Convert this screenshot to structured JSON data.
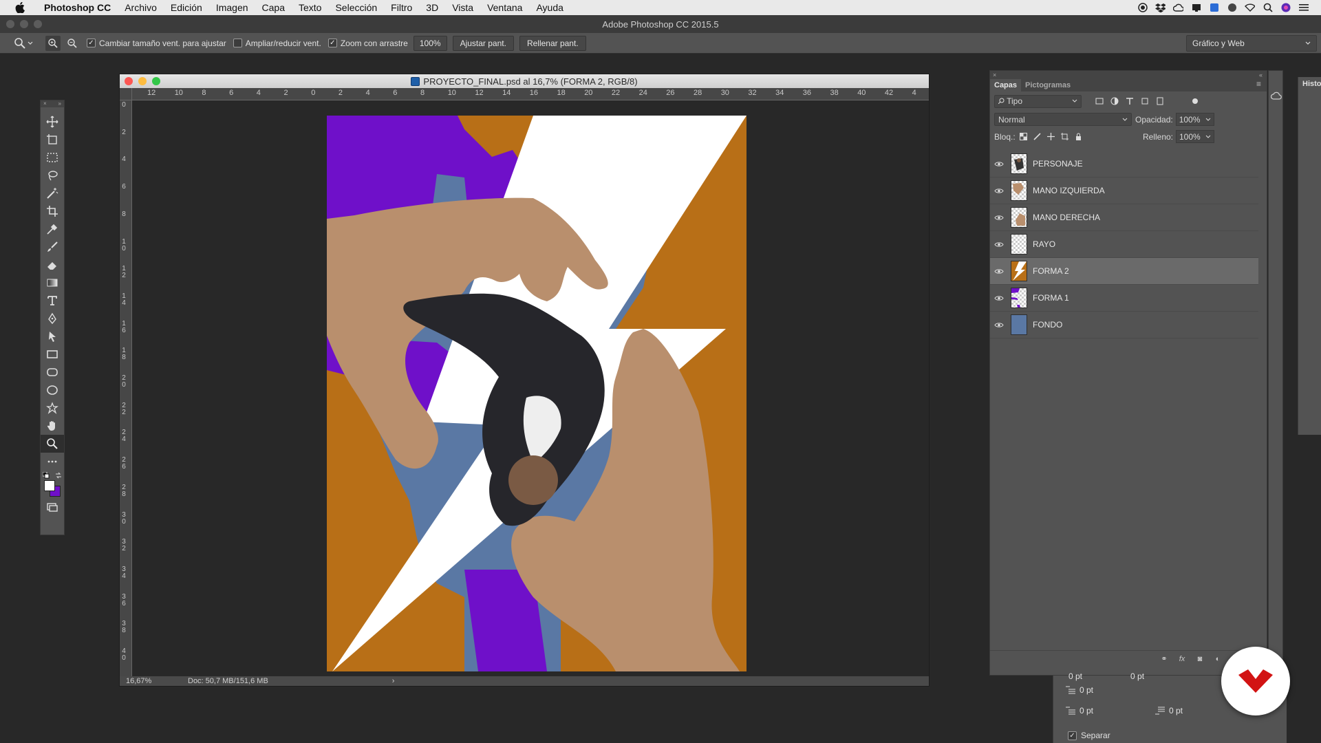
{
  "menubar": {
    "app_name": "Photoshop CC",
    "items": [
      "Archivo",
      "Edición",
      "Imagen",
      "Capa",
      "Texto",
      "Selección",
      "Filtro",
      "3D",
      "Vista",
      "Ventana",
      "Ayuda"
    ]
  },
  "app_title": "Adobe Photoshop CC 2015.5",
  "options": {
    "resize_windows_label": "Cambiar tamaño vent. para ajustar",
    "resize_windows_checked": true,
    "zoom_all_windows_label": "Ampliar/reducir vent.",
    "zoom_all_windows_checked": false,
    "scrubby_zoom_label": "Zoom con arrastre",
    "scrubby_zoom_checked": true,
    "zoom_value": "100%",
    "fit_screen_label": "Ajustar pant.",
    "fill_screen_label": "Rellenar pant.",
    "workspace_label": "Gráfico y Web"
  },
  "document": {
    "title": "PROYECTO_FINAL.psd al 16,7% (FORMA 2, RGB/8)",
    "ruler_h": [
      "12",
      "10",
      "8",
      "6",
      "4",
      "2",
      "0",
      "2",
      "4",
      "6",
      "8",
      "10",
      "12",
      "14",
      "16",
      "18",
      "20",
      "22",
      "24",
      "26",
      "28",
      "30",
      "32",
      "34",
      "36",
      "38",
      "40",
      "42",
      "4"
    ],
    "ruler_v": [
      "0",
      "2",
      "4",
      "6",
      "8",
      "1\n0",
      "1\n2",
      "1\n4",
      "1\n6",
      "1\n8",
      "2\n0",
      "2\n2",
      "2\n4",
      "2\n6",
      "2\n8",
      "3\n0",
      "3\n2",
      "3\n4",
      "3\n6",
      "3\n8",
      "4\n0"
    ],
    "zoom_status": "16,67%",
    "doc_info": "Doc: 50,7 MB/151,6 MB",
    "status_arrow": "›",
    "colors": {
      "purple": "#6f10c9",
      "orange": "#b86f17",
      "blue": "#5a78a4",
      "white": "#ffffff"
    }
  },
  "layers_panel": {
    "tabs": [
      "Capas",
      "Pictogramas"
    ],
    "filter_label": "Tipo",
    "blend_mode": "Normal",
    "opacity_label": "Opacidad:",
    "opacity_value": "100%",
    "lock_label": "Bloq.:",
    "fill_label": "Relleno:",
    "fill_value": "100%",
    "layers": [
      {
        "name": "PERSONAJE",
        "thumb": "person",
        "active": false
      },
      {
        "name": "MANO IZQUIERDA",
        "thumb": "hand",
        "active": false
      },
      {
        "name": "MANO DERECHA",
        "thumb": "hand",
        "active": false
      },
      {
        "name": "RAYO",
        "thumb": "transparent",
        "active": false
      },
      {
        "name": "FORMA 2",
        "thumb": "orange",
        "active": true
      },
      {
        "name": "FORMA 1",
        "thumb": "purple",
        "active": false
      },
      {
        "name": "FONDO",
        "thumb": "blue",
        "active": false
      }
    ]
  },
  "history_panel": {
    "title": "Histo"
  },
  "paragraph_panel": {
    "indent_first": "0 pt",
    "space_before": "0 pt",
    "space_after": "0 pt",
    "top_partial_left": "0 pt",
    "top_partial_right": "0 pt",
    "hyphenate_label": "Separar",
    "hyphenate_checked": true
  }
}
